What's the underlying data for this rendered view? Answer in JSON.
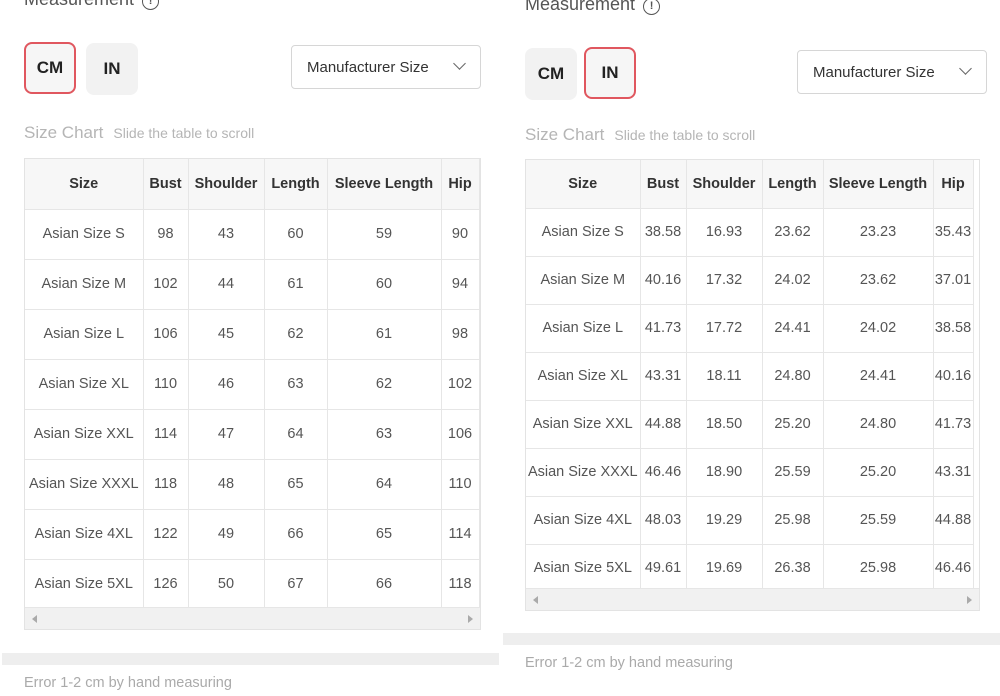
{
  "left": {
    "measurement_label": "Measurement",
    "units": [
      "CM",
      "IN"
    ],
    "active_unit": "CM",
    "size_select": "Manufacturer Size",
    "chart_title": "Size Chart",
    "chart_hint": "Slide the table to scroll",
    "columns": [
      "Size",
      "Bust",
      "Shoulder",
      "Length",
      "Sleeve Length",
      "Hip"
    ],
    "rows": [
      [
        "Asian Size S",
        "98",
        "43",
        "60",
        "59",
        "90"
      ],
      [
        "Asian Size M",
        "102",
        "44",
        "61",
        "60",
        "94"
      ],
      [
        "Asian Size L",
        "106",
        "45",
        "62",
        "61",
        "98"
      ],
      [
        "Asian Size XL",
        "110",
        "46",
        "63",
        "62",
        "102"
      ],
      [
        "Asian Size XXL",
        "114",
        "47",
        "64",
        "63",
        "106"
      ],
      [
        "Asian Size XXXL",
        "118",
        "48",
        "65",
        "64",
        "110"
      ],
      [
        "Asian Size 4XL",
        "122",
        "49",
        "66",
        "65",
        "114"
      ],
      [
        "Asian Size 5XL",
        "126",
        "50",
        "67",
        "66",
        "118"
      ]
    ],
    "note": "Error 1-2 cm by hand measuring"
  },
  "right": {
    "measurement_label": "Measurement",
    "units": [
      "CM",
      "IN"
    ],
    "active_unit": "IN",
    "size_select": "Manufacturer Size",
    "chart_title": "Size Chart",
    "chart_hint": "Slide the table to scroll",
    "columns": [
      "Size",
      "Bust",
      "Shoulder",
      "Length",
      "Sleeve Length",
      "Hip"
    ],
    "rows": [
      [
        "Asian Size S",
        "38.58",
        "16.93",
        "23.62",
        "23.23",
        "35.43"
      ],
      [
        "Asian Size M",
        "40.16",
        "17.32",
        "24.02",
        "23.62",
        "37.01"
      ],
      [
        "Asian Size L",
        "41.73",
        "17.72",
        "24.41",
        "24.02",
        "38.58"
      ],
      [
        "Asian Size XL",
        "43.31",
        "18.11",
        "24.80",
        "24.41",
        "40.16"
      ],
      [
        "Asian Size XXL",
        "44.88",
        "18.50",
        "25.20",
        "24.80",
        "41.73"
      ],
      [
        "Asian Size XXXL",
        "46.46",
        "18.90",
        "25.59",
        "25.20",
        "43.31"
      ],
      [
        "Asian Size 4XL",
        "48.03",
        "19.29",
        "25.98",
        "25.59",
        "44.88"
      ],
      [
        "Asian Size 5XL",
        "49.61",
        "19.69",
        "26.38",
        "25.98",
        "46.46"
      ]
    ],
    "note": "Error 1-2 cm by hand measuring"
  },
  "colors": {
    "active_border": "#e0575f",
    "muted_text": "#b5b5b5"
  },
  "icons": {
    "info": "info-icon",
    "dropdown": "chevron-down-icon",
    "scroll_left": "arrow-left-icon",
    "scroll_right": "arrow-right-icon"
  }
}
